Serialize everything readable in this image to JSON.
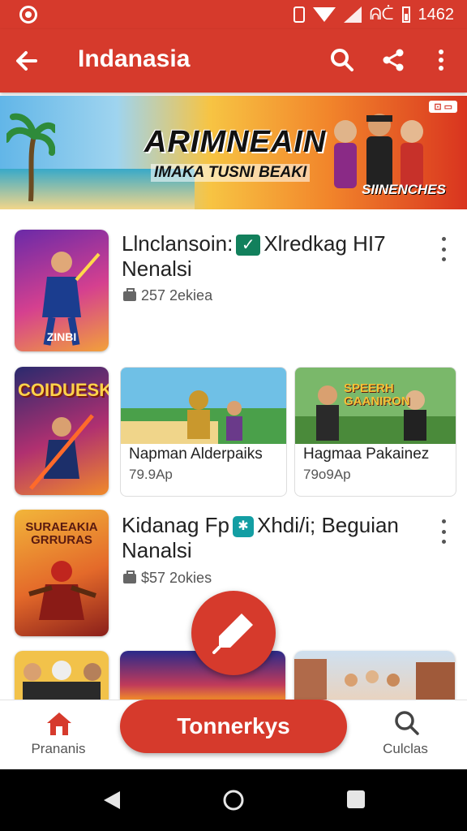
{
  "status_bar": {
    "network": "ᕱᑖ",
    "time": "1462"
  },
  "app_bar": {
    "title": "Indanasia",
    "back_icon": "arrow-left-icon",
    "search_icon": "search-icon",
    "share_icon": "share-icon",
    "more_icon": "more-vert-icon"
  },
  "banner": {
    "title": "ARIMNEAIN",
    "subtitle": "IMAKA TUSNI BEAKI",
    "badge": "SIINENCHES",
    "chip": "⊡ ▭"
  },
  "list": [
    {
      "thumb_caption": "ZINBI",
      "title_a": "Llnclansoin:",
      "title_b": "Xlredkag HI7",
      "title_c": "Nenalsi",
      "meta": "257 2ekiea"
    },
    {
      "thumb_caption": "COIDUESK"
    },
    {
      "thumb_caption": "SURAEAKIA GRRURAS",
      "title_a": "Kidanag Fp",
      "title_b": "Xhdi/i; Beguian",
      "title_c": "Nanalsi",
      "meta": "$57 2okies"
    }
  ],
  "cards": [
    {
      "name": "Napman Alderpaiks",
      "price": "79.9Ap"
    },
    {
      "name": "Hagmaa Pakainez",
      "price": "79o9Ap",
      "art_text": "SPEERH GAANIRON"
    }
  ],
  "bottom_nav": {
    "home_label": "Prananis",
    "search_label": "Culclas",
    "cta_label": "Tonnerkys"
  },
  "colors": {
    "brand": "#d63a2c",
    "check": "#12805c",
    "teal": "#139ea3"
  }
}
